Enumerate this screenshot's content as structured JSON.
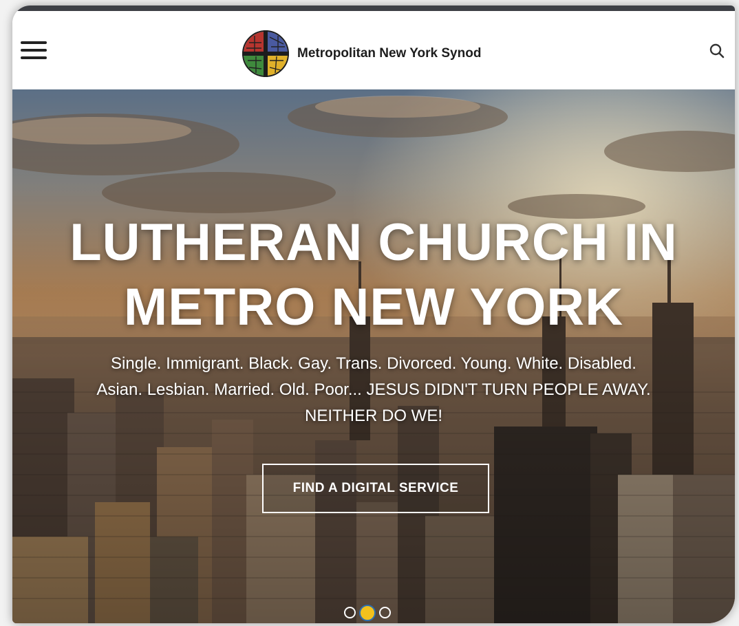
{
  "header": {
    "site_name": "Metropolitan New York Synod",
    "menu_icon": "hamburger-menu-icon",
    "search_icon": "search-icon",
    "logo_icon": "synod-cross-logo"
  },
  "hero": {
    "title_line1": "LUTHERAN CHURCH IN",
    "title_line2": "METRO NEW YORK",
    "subtitle_line1": "Single. Immigrant. Black. Gay. Trans. Divorced. Young. White. Disabled.",
    "subtitle_line2": "Asian. Lesbian. Married. Old. Poor... JESUS DIDN'T TURN PEOPLE AWAY.",
    "subtitle_line3": "NEITHER DO WE!",
    "cta_label": "FIND A DIGITAL SERVICE"
  },
  "carousel": {
    "slide_count": 3,
    "active_slide": 2
  },
  "colors": {
    "accent_dot": "#f2c11d",
    "header_bg": "#ffffff",
    "hero_text": "#ffffff"
  }
}
